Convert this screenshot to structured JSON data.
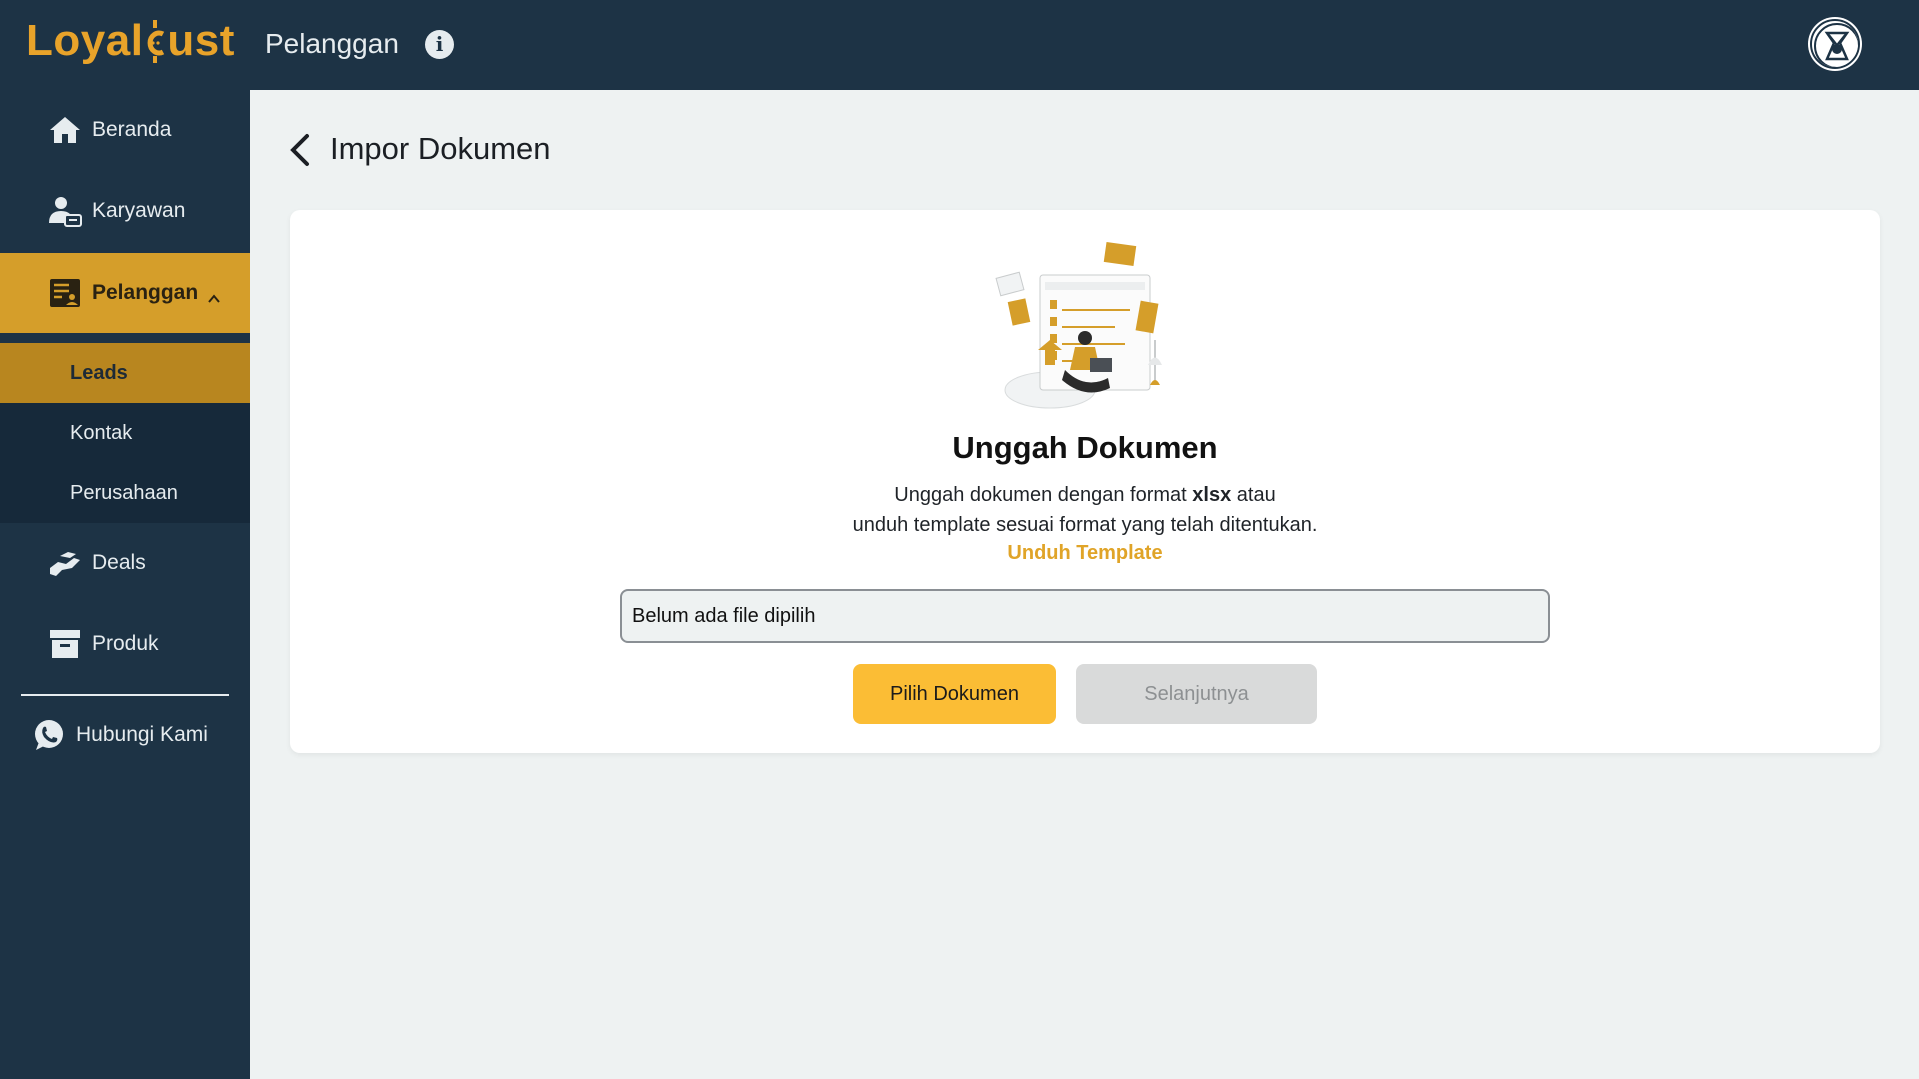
{
  "header": {
    "logo_prefix": "Loyal",
    "logo_suffix": "ust",
    "page_title": "Pelanggan",
    "info_icon": "info-icon",
    "avatar_icon": "user-avatar-icon"
  },
  "sidebar": {
    "items": [
      {
        "label": "Beranda",
        "icon": "home-icon"
      },
      {
        "label": "Karyawan",
        "icon": "employee-icon"
      },
      {
        "label": "Pelanggan",
        "icon": "customer-icon",
        "active": true,
        "expanded": true
      },
      {
        "label": "Deals",
        "icon": "handshake-icon"
      },
      {
        "label": "Produk",
        "icon": "archive-box-icon"
      }
    ],
    "sub_items": [
      {
        "label": "Leads",
        "active": true
      },
      {
        "label": "Kontak"
      },
      {
        "label": "Perusahaan"
      }
    ],
    "contact": {
      "label": "Hubungi Kami",
      "icon": "whatsapp-icon"
    }
  },
  "main": {
    "title": "Impor Dokumen",
    "card": {
      "title": "Unggah Dokumen",
      "desc_line1_before": "Unggah dokumen dengan format ",
      "desc_line1_bold": "xlsx",
      "desc_line1_after": " atau",
      "desc_line2": "unduh template sesuai format yang telah ditentukan.",
      "template_link": "Unduh Template",
      "file_status": "Belum ada file dipilih",
      "choose_button": "Pilih Dokumen",
      "next_button": "Selanjutnya"
    }
  },
  "colors": {
    "sidebar_bg": "#1d3345",
    "accent": "#d59e2a",
    "accent_dark": "#b8861f",
    "primary_button": "#fbbd35",
    "disabled_button": "#d9dada",
    "link": "#e0a428"
  }
}
